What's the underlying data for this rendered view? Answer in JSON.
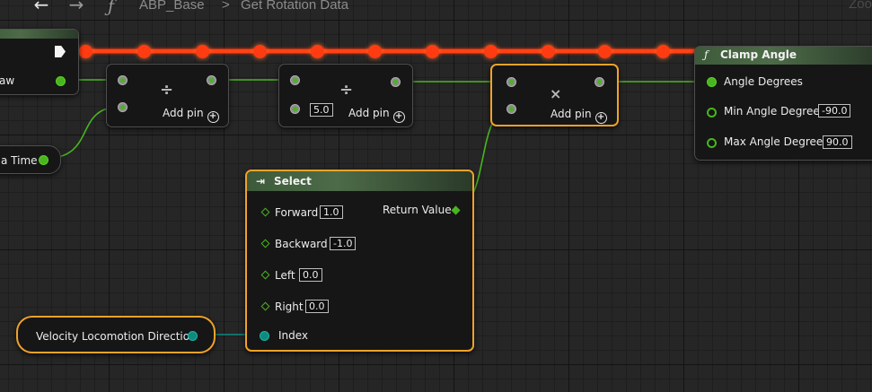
{
  "toolbar": {
    "back_icon": "arrow-left-icon",
    "forward_icon": "arrow-right-icon",
    "function_icon": "function-icon",
    "breadcrumb_root": "ABP_Base",
    "breadcrumb_sep": ">",
    "breadcrumb_current": "Get Rotation Data",
    "zoom_label": "Zoo"
  },
  "nodes": {
    "left_top": {
      "label": "aw"
    },
    "left_delta": {
      "label": "a Time"
    },
    "divide1": {
      "op": "÷",
      "add_pin": "Add pin"
    },
    "divide2": {
      "op": "÷",
      "value": "5.0",
      "add_pin": "Add pin"
    },
    "multiply": {
      "op": "×",
      "add_pin": "Add pin"
    },
    "clamp": {
      "title": "Clamp Angle",
      "icon": "ƒ",
      "angle_degrees": "Angle Degrees",
      "min_label": "Min Angle Degrees",
      "min_value": "-90.0",
      "max_label": "Max Angle Degrees",
      "max_value": "90.0"
    },
    "select": {
      "title": "Select",
      "forward_label": "Forward",
      "forward_value": "1.0",
      "backward_label": "Backward",
      "backward_value": "-1.0",
      "left_label": "Left",
      "left_value": "0.0",
      "right_label": "Right",
      "right_value": "0.0",
      "index_label": "Index",
      "return_label": "Return Value"
    },
    "velocity": {
      "label": "Velocity Locomotion Direction"
    }
  },
  "colors": {
    "exec_wire": "#ff3b12",
    "float_wire": "#48b51e",
    "enum_wire": "#0f8a7e",
    "selection": "#f0a22a"
  }
}
